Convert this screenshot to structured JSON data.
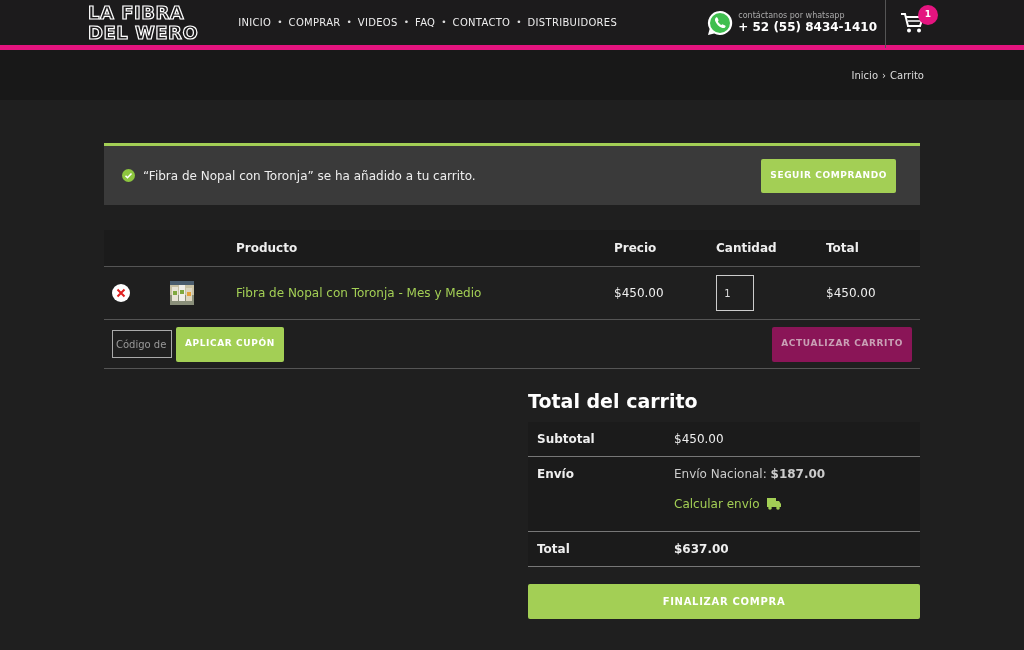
{
  "header": {
    "logo_lines": [
      "LA FIBRA",
      "DEL WERO"
    ],
    "nav": [
      {
        "label": "INICIO"
      },
      {
        "label": "COMPRAR"
      },
      {
        "label": "VIDEOS"
      },
      {
        "label": "FAQ"
      },
      {
        "label": "CONTACTO"
      },
      {
        "label": "DISTRIBUIDORES"
      }
    ],
    "nav_separator": "•",
    "whatsapp": {
      "caption": "contáctanos por whatsapp",
      "phone": "+ 52 (55) 8434-1410"
    },
    "cart_count": "1"
  },
  "breadcrumb": {
    "items": [
      "Inicio",
      "Carrito"
    ],
    "separator": "›"
  },
  "notice": {
    "message": "“Fibra de Nopal con Toronja” se ha añadido a tu carrito.",
    "button": "SEGUIR COMPRANDO"
  },
  "cart_table": {
    "columns": [
      "Producto",
      "Precio",
      "Cantidad",
      "Total"
    ],
    "rows": [
      {
        "product": "Fibra de Nopal con Toronja - Mes y Medio",
        "price": "$450.00",
        "quantity": "1",
        "total": "$450.00"
      }
    ],
    "coupon_placeholder": "Código de",
    "apply_button": "APLICAR CUPÓN",
    "update_button": "ACTUALIZAR CARRITO",
    "update_disabled": true
  },
  "totals": {
    "title": "Total del carrito",
    "rows": [
      {
        "kind": "plain",
        "label": "Subtotal",
        "value": "$450.00"
      },
      {
        "kind": "shipping",
        "label": "Envío",
        "value": "Envío Nacional: **$187.00**",
        "link": "Calcular envío"
      },
      {
        "kind": "total",
        "label": "Total",
        "value": "$637.00"
      }
    ],
    "checkout_button": "FINALIZAR COMPRA"
  }
}
